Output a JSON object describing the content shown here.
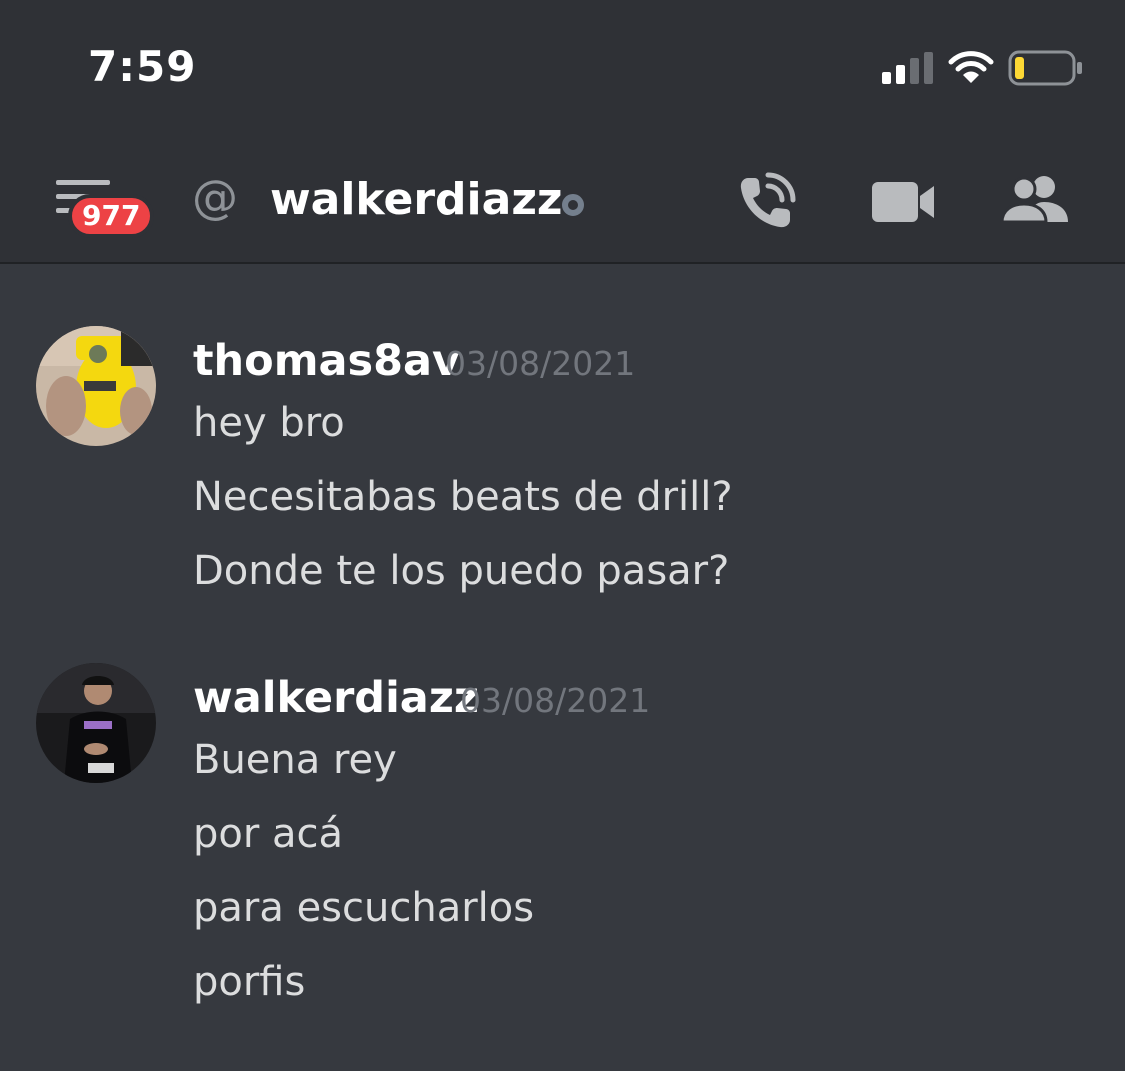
{
  "status_bar": {
    "time": "7:59"
  },
  "header": {
    "unread_badge": "977",
    "at_symbol": "@",
    "channel_name": "walkerdiazz",
    "icons": [
      "menu-icon",
      "call-icon",
      "video-icon",
      "members-icon"
    ]
  },
  "messages": [
    {
      "username": "thomas8av",
      "timestamp": "03/08/2021",
      "lines": [
        "hey bro",
        "Necesitabas beats de drill?",
        "Donde te los puedo pasar?"
      ]
    },
    {
      "username": "walkerdiazz",
      "timestamp": "03/08/2021",
      "lines": [
        "Buena rey",
        "por acá",
        "para escucharlos",
        "porfis"
      ]
    }
  ],
  "colors": {
    "background": "#36393f",
    "header": "#2f3136",
    "badge": "#ed4245",
    "timestamp": "#72767d",
    "message_text": "#dcddde",
    "battery_low": "#fdd835"
  }
}
